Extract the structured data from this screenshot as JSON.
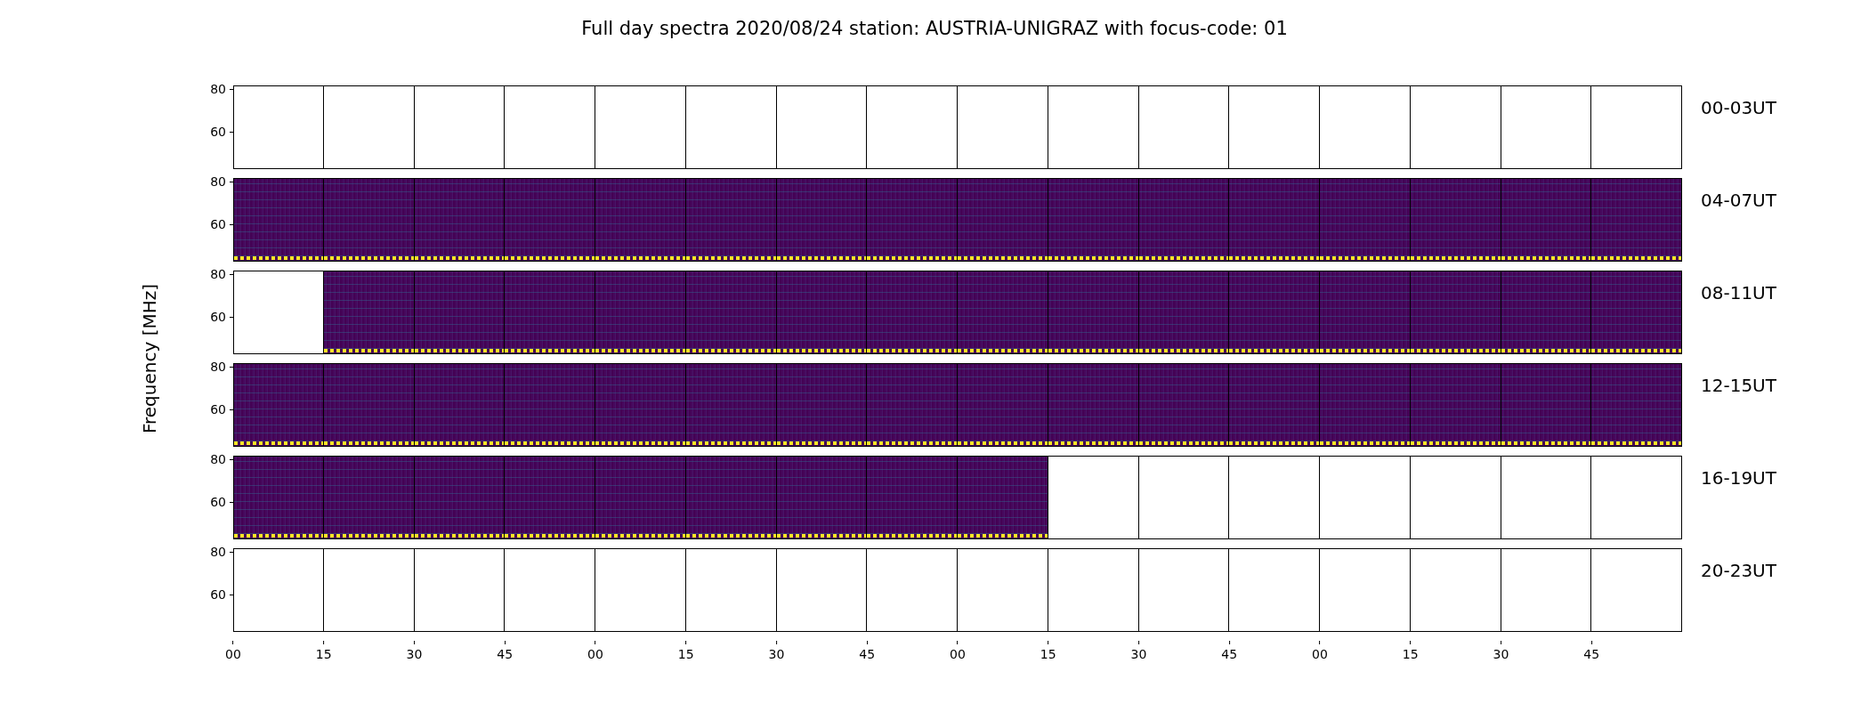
{
  "title": "Full day spectra 2020/08/24 station: AUSTRIA-UNIGRAZ with focus-code: 01",
  "ylabel": "Frequency [MHz]",
  "rows": [
    {
      "label": "00-03UT",
      "yticks": [
        "80",
        "60"
      ],
      "panels": [
        {
          "filled": false
        },
        {
          "filled": false
        },
        {
          "filled": false
        },
        {
          "filled": false
        },
        {
          "filled": false
        },
        {
          "filled": false
        },
        {
          "filled": false
        },
        {
          "filled": false
        },
        {
          "filled": false
        },
        {
          "filled": false
        },
        {
          "filled": false
        },
        {
          "filled": false
        },
        {
          "filled": false
        },
        {
          "filled": false
        },
        {
          "filled": false
        },
        {
          "filled": false
        }
      ]
    },
    {
      "label": "04-07UT",
      "yticks": [
        "80",
        "60"
      ],
      "panels": [
        {
          "filled": true
        },
        {
          "filled": true
        },
        {
          "filled": true
        },
        {
          "filled": true
        },
        {
          "filled": true
        },
        {
          "filled": true
        },
        {
          "filled": true
        },
        {
          "filled": true
        },
        {
          "filled": true
        },
        {
          "filled": true
        },
        {
          "filled": true
        },
        {
          "filled": true
        },
        {
          "filled": true
        },
        {
          "filled": true
        },
        {
          "filled": true
        },
        {
          "filled": true
        }
      ]
    },
    {
      "label": "08-11UT",
      "yticks": [
        "80",
        "60"
      ],
      "panels": [
        {
          "filled": false
        },
        {
          "filled": true
        },
        {
          "filled": true
        },
        {
          "filled": true
        },
        {
          "filled": true
        },
        {
          "filled": true
        },
        {
          "filled": true
        },
        {
          "filled": true
        },
        {
          "filled": true
        },
        {
          "filled": true
        },
        {
          "filled": true
        },
        {
          "filled": true
        },
        {
          "filled": true
        },
        {
          "filled": true
        },
        {
          "filled": true
        },
        {
          "filled": true
        }
      ]
    },
    {
      "label": "12-15UT",
      "yticks": [
        "80",
        "60"
      ],
      "panels": [
        {
          "filled": true
        },
        {
          "filled": true
        },
        {
          "filled": true
        },
        {
          "filled": true
        },
        {
          "filled": true
        },
        {
          "filled": true
        },
        {
          "filled": true
        },
        {
          "filled": true
        },
        {
          "filled": true
        },
        {
          "filled": true
        },
        {
          "filled": true
        },
        {
          "filled": true
        },
        {
          "filled": true
        },
        {
          "filled": true
        },
        {
          "filled": true
        },
        {
          "filled": true
        }
      ]
    },
    {
      "label": "16-19UT",
      "yticks": [
        "80",
        "60"
      ],
      "panels": [
        {
          "filled": true
        },
        {
          "filled": true
        },
        {
          "filled": true
        },
        {
          "filled": true
        },
        {
          "filled": true
        },
        {
          "filled": true
        },
        {
          "filled": true
        },
        {
          "filled": true
        },
        {
          "filled": true
        },
        {
          "filled": false
        },
        {
          "filled": false
        },
        {
          "filled": false
        },
        {
          "filled": false
        },
        {
          "filled": false
        },
        {
          "filled": false
        },
        {
          "filled": false
        }
      ]
    },
    {
      "label": "20-23UT",
      "yticks": [
        "80",
        "60"
      ],
      "panels": [
        {
          "filled": false
        },
        {
          "filled": false
        },
        {
          "filled": false
        },
        {
          "filled": false
        },
        {
          "filled": false
        },
        {
          "filled": false
        },
        {
          "filled": false
        },
        {
          "filled": false
        },
        {
          "filled": false
        },
        {
          "filled": false
        },
        {
          "filled": false
        },
        {
          "filled": false
        },
        {
          "filled": false
        },
        {
          "filled": false
        },
        {
          "filled": false
        },
        {
          "filled": false
        }
      ]
    }
  ],
  "xticks": [
    "00",
    "15",
    "30",
    "45",
    "00",
    "15",
    "30",
    "45",
    "00",
    "15",
    "30",
    "45",
    "00",
    "15",
    "30",
    "45"
  ]
}
